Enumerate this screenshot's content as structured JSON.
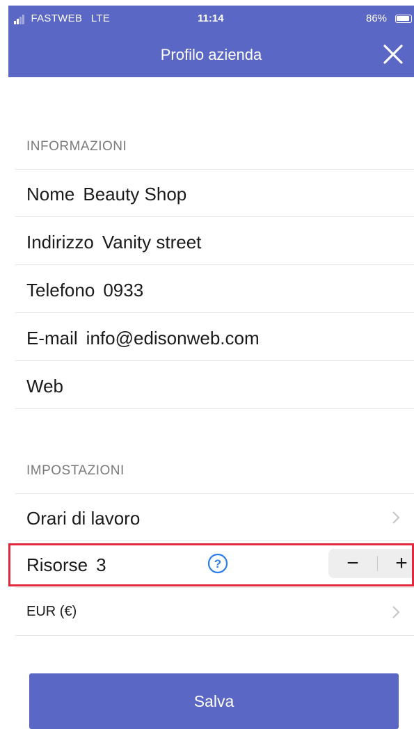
{
  "status_bar": {
    "carrier": "FASTWEB",
    "network": "LTE",
    "time": "11:14",
    "battery": "86%",
    "icons": [
      "signal-icon",
      "battery-icon"
    ]
  },
  "nav": {
    "title": "Profilo azienda",
    "close_icon": "close-icon"
  },
  "sections": {
    "info": {
      "header": "INFORMAZIONI",
      "rows": [
        {
          "label": "Nome",
          "value": "Beauty Shop"
        },
        {
          "label": "Indirizzo",
          "value": "Vanity street"
        },
        {
          "label": "Telefono",
          "value": "0933"
        },
        {
          "label": "E-mail",
          "value": "info@edisonweb.com"
        },
        {
          "label": "Web",
          "value": ""
        }
      ]
    },
    "settings": {
      "header": "IMPOSTAZIONI",
      "work_hours": {
        "label": "Orari di lavoro"
      },
      "resources": {
        "label": "Risorse",
        "value": "3",
        "help_icon": "help-icon",
        "minus": "−",
        "plus": "+"
      },
      "currency": {
        "label": "EUR (€)"
      }
    }
  },
  "save_button": {
    "label": "Salva"
  },
  "colors": {
    "primary": "#5b67c4",
    "highlight": "#e0293c",
    "help": "#2b7de9"
  }
}
